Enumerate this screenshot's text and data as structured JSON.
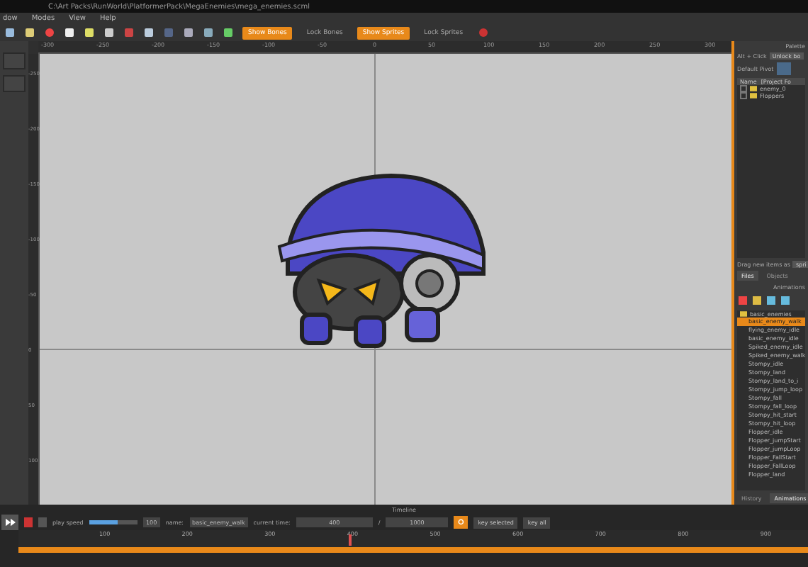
{
  "window": {
    "title": "C:\\Art Packs\\RunWorld\\PlatformerPack\\MegaEnemies\\mega_enemies.scml"
  },
  "menu": [
    "dow",
    "Modes",
    "View",
    "Help"
  ],
  "toolbar": {
    "toggles": [
      {
        "label": "Show Bones",
        "on": true
      },
      {
        "label": "Lock Bones",
        "on": false
      },
      {
        "label": "Show Sprites",
        "on": true
      },
      {
        "label": "Lock Sprites",
        "on": false
      }
    ]
  },
  "ruler": {
    "x_labels": [
      "-300",
      "-250",
      "-200",
      "-150",
      "-100",
      "-50",
      "0",
      "50",
      "100",
      "150",
      "200",
      "250",
      "300"
    ],
    "y_labels": [
      "-250",
      "-200",
      "-150",
      "-100",
      "-50",
      "0",
      "50",
      "100"
    ]
  },
  "palette": {
    "title": "Palette",
    "alt_click": "Alt + Click",
    "alt_value": "Unlock bo",
    "default_pivot": "Default Pivot",
    "columns": [
      "Name",
      "[Project Fo"
    ],
    "items": [
      {
        "name": "enemy_0",
        "expanded": false
      },
      {
        "name": "Floppers",
        "expanded": false
      }
    ],
    "drag_label": "Drag new items as",
    "drag_value": "spri",
    "tabs": [
      {
        "label": "Files",
        "selected": true
      },
      {
        "label": "Objects",
        "selected": false
      }
    ]
  },
  "animations": {
    "title": "Animations",
    "folder": "basic_enemies",
    "items": [
      {
        "name": "basic_enemy_walk",
        "selected": true
      },
      {
        "name": "flying_enemy_idle",
        "selected": false
      },
      {
        "name": "basic_enemy_idle",
        "selected": false
      },
      {
        "name": "Spiked_enemy_idle",
        "selected": false
      },
      {
        "name": "Spiked_enemy_walk",
        "selected": false
      },
      {
        "name": "Stompy_idle",
        "selected": false
      },
      {
        "name": "Stompy_land",
        "selected": false
      },
      {
        "name": "Stompy_land_to_i",
        "selected": false
      },
      {
        "name": "Stompy_jump_loop",
        "selected": false
      },
      {
        "name": "Stompy_fall",
        "selected": false
      },
      {
        "name": "Stompy_fall_loop",
        "selected": false
      },
      {
        "name": "Stompy_hit_start",
        "selected": false
      },
      {
        "name": "Stompy_hit_loop",
        "selected": false
      },
      {
        "name": "Flopper_idle",
        "selected": false
      },
      {
        "name": "Flopper_jumpStart",
        "selected": false
      },
      {
        "name": "Flopper_jumpLoop",
        "selected": false
      },
      {
        "name": "Flopper_FallStart",
        "selected": false
      },
      {
        "name": "Flopper_FallLoop",
        "selected": false
      },
      {
        "name": "Flopper_land",
        "selected": false
      }
    ],
    "tabs": [
      {
        "label": "History",
        "selected": false
      },
      {
        "label": "Animations",
        "selected": true
      }
    ]
  },
  "timeline": {
    "title": "Timeline",
    "play_speed_label": "play speed",
    "play_speed": {
      "level": 0.6
    },
    "speed_value": "100",
    "name_label": "name:",
    "name": "basic_enemy_walk",
    "time_label": "current time:",
    "current_time": "400",
    "separator": "/",
    "length": "1000",
    "key_selected": "key selected",
    "key_all": "key all",
    "ticks": [
      "100",
      "200",
      "300",
      "400",
      "500",
      "600",
      "700",
      "800",
      "900"
    ],
    "playhead": {
      "level": 0.4
    }
  }
}
